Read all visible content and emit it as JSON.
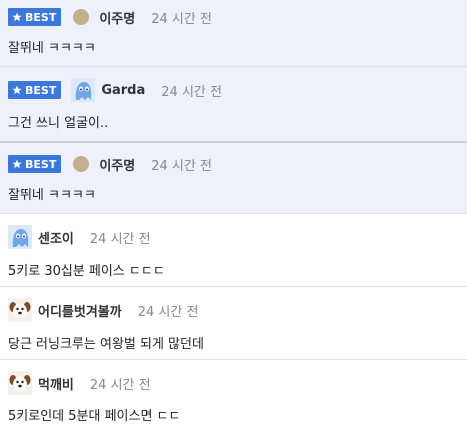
{
  "comments": [
    {
      "best": true,
      "badge_label": "BEST",
      "nickname": "이주명",
      "time": "24 시간 전",
      "text": "잘뛰네 ㅋㅋㅋㅋ",
      "avatar": "dot"
    },
    {
      "best": true,
      "badge_label": "BEST",
      "nickname": "Garda",
      "time": "24 시간 전",
      "text": "그건 쓰니 얼굴이..",
      "avatar": "ghost"
    },
    {
      "best": true,
      "badge_label": "BEST",
      "nickname": "이주명",
      "time": "24 시간 전",
      "text": "잘뛰네 ㅋㅋㅋㅋ",
      "avatar": "dot"
    },
    {
      "best": false,
      "nickname": "센조이",
      "time": "24 시간 전",
      "text": "5키로 30십분 페이스 ㄷㄷㄷ",
      "avatar": "ghost"
    },
    {
      "best": false,
      "nickname": "어디를벗겨볼까",
      "time": "24 시간 전",
      "text": "당근 러닝크루는 여왕벌 되게 많던데",
      "avatar": "dog"
    },
    {
      "best": false,
      "nickname": "먹깨비",
      "time": "24 시간 전",
      "text": "5키로인데 5분대 페이스면 ㄷㄷ",
      "avatar": "dog"
    }
  ],
  "colors": {
    "best_bg": "#eef1fb",
    "badge_bg": "#3c78d8",
    "time": "#888888"
  }
}
